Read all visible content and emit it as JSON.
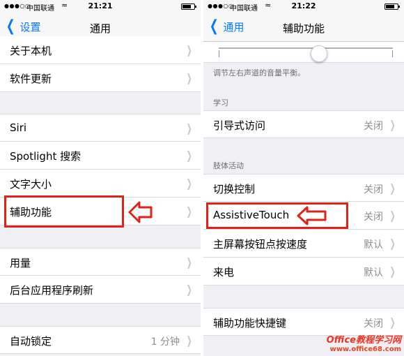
{
  "left": {
    "status": {
      "carrier": "中国联通",
      "time": "21:21"
    },
    "nav": {
      "back_label": "设置",
      "title": "通用"
    },
    "rows": [
      {
        "label": "关于本机"
      },
      {
        "label": "软件更新"
      },
      {
        "label": "Siri"
      },
      {
        "label": "Spotlight 搜索"
      },
      {
        "label": "文字大小"
      },
      {
        "label": "辅助功能"
      },
      {
        "label": "用量"
      },
      {
        "label": "后台应用程序刷新"
      },
      {
        "label": "自动锁定",
        "value": "1 分钟"
      }
    ]
  },
  "right": {
    "status": {
      "carrier": "中国联通",
      "time": "21:22"
    },
    "nav": {
      "back_label": "通用",
      "title": "辅助功能"
    },
    "balance_note": "调节左右声道的音量平衡。",
    "sections": {
      "learning": "学习",
      "physical": "肢体活动"
    },
    "rows": [
      {
        "label": "引导式访问",
        "value": "关闭"
      },
      {
        "label": "切换控制",
        "value": "关闭"
      },
      {
        "label": "AssistiveTouch",
        "value": "关闭"
      },
      {
        "label": "主屏幕按钮点按速度",
        "value": "默认"
      },
      {
        "label": "来电",
        "value": "默认"
      },
      {
        "label": "辅助功能快捷键",
        "value": "关闭"
      }
    ]
  },
  "watermark": {
    "line1": "Office教程学习网",
    "line2": "www.office68.com"
  },
  "colors": {
    "accent": "#007aff",
    "highlight": "#e0221a"
  }
}
